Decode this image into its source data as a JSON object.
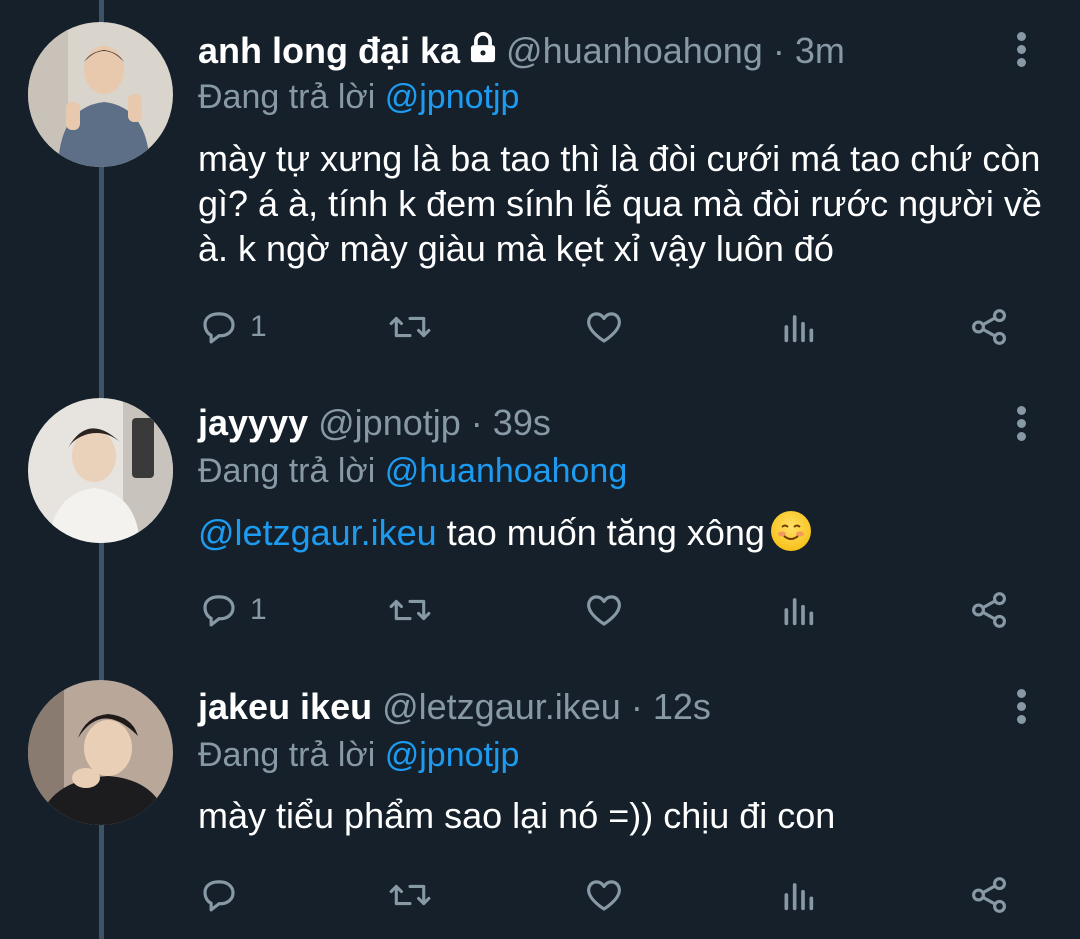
{
  "tweets": [
    {
      "name": "anh long đại ka",
      "handle": "@huanhoahong",
      "sep": "·",
      "time": "3m",
      "locked": true,
      "reply_prefix": "Đang trả lời",
      "reply_to": "@jpnotjp",
      "text": "mày tự xưng là ba tao thì là đòi cưới má tao chứ còn gì? á à, tính k đem sính lễ qua mà đòi rước người về à. k ngờ mày giàu mà kẹt xỉ vậy luôn đó",
      "reply_count": "1"
    },
    {
      "name": "jayyyy",
      "handle": "@jpnotjp",
      "sep": "·",
      "time": "39s",
      "locked": false,
      "reply_prefix": "Đang trả lời",
      "reply_to": "@huanhoahong",
      "mention": "@letzgaur.ikeu",
      "text": "tao muốn tăng xông",
      "emoji": "smiling-face-icon",
      "reply_count": "1"
    },
    {
      "name": "jakeu ikeu",
      "handle": "@letzgaur.ikeu",
      "sep": "·",
      "time": "12s",
      "locked": false,
      "reply_prefix": "Đang trả lời",
      "reply_to": "@jpnotjp",
      "text": "mày tiểu phẩm sao lại nó =)) chịu đi con",
      "reply_count": ""
    }
  ],
  "colors": {
    "background": "#15202b",
    "secondary_text": "#8899a6",
    "link": "#1d9bf0",
    "thread_line": "#3d5466"
  },
  "icons": [
    "reply-icon",
    "retweet-icon",
    "like-icon",
    "analytics-icon",
    "share-icon",
    "more-icon",
    "lock-icon"
  ]
}
